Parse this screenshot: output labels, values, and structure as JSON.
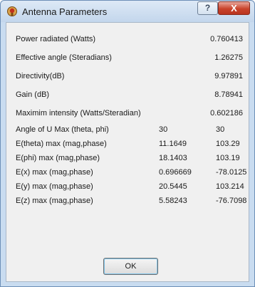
{
  "window": {
    "title": "Antenna Parameters",
    "help_label": "?",
    "close_label": "X"
  },
  "summary": [
    {
      "label": "Power radiated (Watts)",
      "value": "0.760413"
    },
    {
      "label": "Effective angle (Steradians)",
      "value": "1.26275"
    },
    {
      "label": "Directivity(dB)",
      "value": "9.97891"
    },
    {
      "label": "Gain (dB)",
      "value": "8.78941"
    },
    {
      "label": "Maximim intensity (Watts/Steradian)",
      "value": "0.602186"
    }
  ],
  "details": [
    {
      "label": "Angle of U Max (theta, phi)",
      "col1": "30",
      "col2": "30"
    },
    {
      "label": "E(theta) max (mag,phase)",
      "col1": "11.1649",
      "col2": "103.29"
    },
    {
      "label": "E(phi) max (mag,phase)",
      "col1": "18.1403",
      "col2": "103.19"
    },
    {
      "label": "E(x) max (mag,phase)",
      "col1": "0.696669",
      "col2": "-78.0125"
    },
    {
      "label": "E(y) max (mag,phase)",
      "col1": "20.5445",
      "col2": "103.214"
    },
    {
      "label": "E(z) max (mag,phase)",
      "col1": "5.58243",
      "col2": "-76.7098"
    }
  ],
  "ok_label": "OK",
  "colors": {
    "close": "#c9432c",
    "client": "#f0f0f0",
    "frame": "#c9dcf0"
  }
}
